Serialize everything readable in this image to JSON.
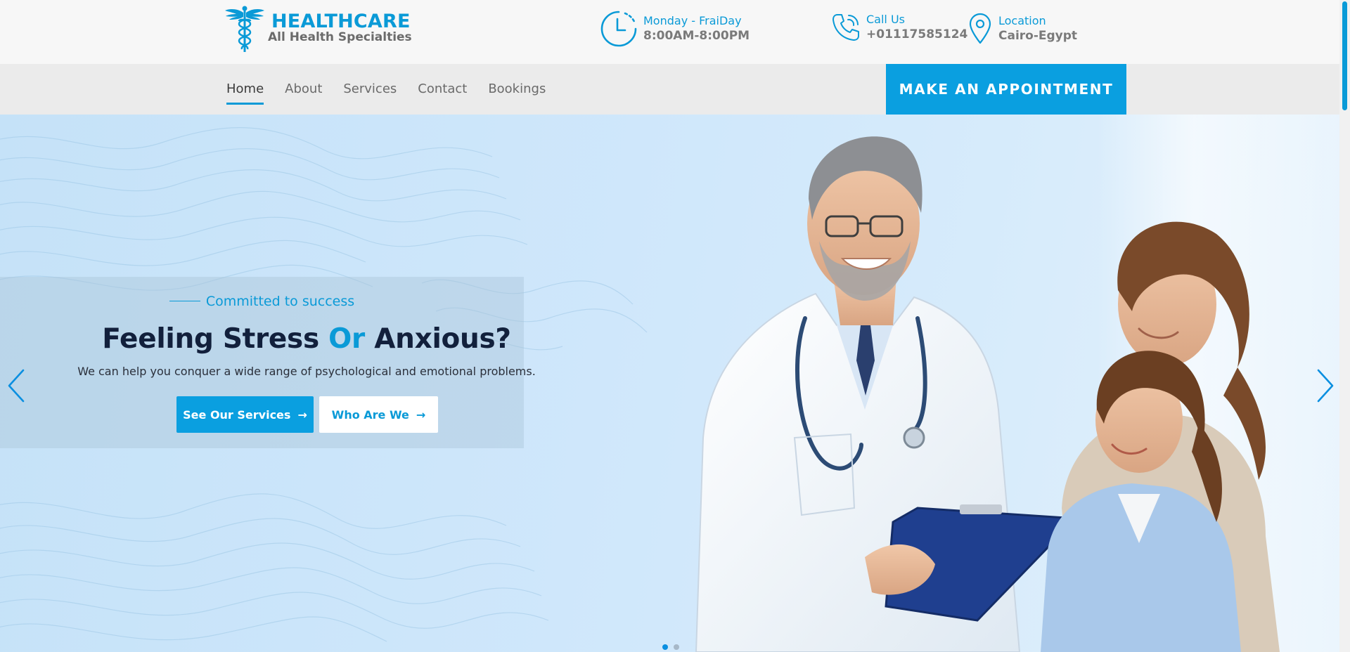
{
  "brand": {
    "title": "HEALTHCARE",
    "subtitle": "All Health Specialties",
    "logo_icon": "caduceus-icon",
    "color": "#0a9ad7"
  },
  "contact": {
    "hours": {
      "label": "Monday - FraiDay",
      "value": "8:00AM-8:00PM",
      "icon": "clock-icon"
    },
    "call": {
      "label": "Call Us",
      "value": "+01117585124",
      "icon": "phone-icon"
    },
    "location": {
      "label": "Location",
      "value": "Cairo-Egypt",
      "icon": "map-pin-icon"
    }
  },
  "nav": {
    "items": [
      {
        "label": "Home",
        "active": true
      },
      {
        "label": "About",
        "active": false
      },
      {
        "label": "Services",
        "active": false
      },
      {
        "label": "Contact",
        "active": false
      },
      {
        "label": "Bookings",
        "active": false
      }
    ],
    "cta_label": "MAKE AN APPOINTMENT"
  },
  "hero": {
    "kicker": "Committed to success",
    "headline_part1": "Feeling Stress ",
    "headline_accent": "Or",
    "headline_part2": " Anxious?",
    "description": "We can help you conquer a wide range of psychological and emotional problems.",
    "primary_button": "See Our Services",
    "secondary_button": "Who Are We",
    "slides": {
      "count": 2,
      "current": 1
    }
  },
  "colors": {
    "accent": "#0a9fe0",
    "headline": "#12203c",
    "topbar_bg": "#f7f7f7",
    "navbar_bg": "#ebebeb"
  }
}
